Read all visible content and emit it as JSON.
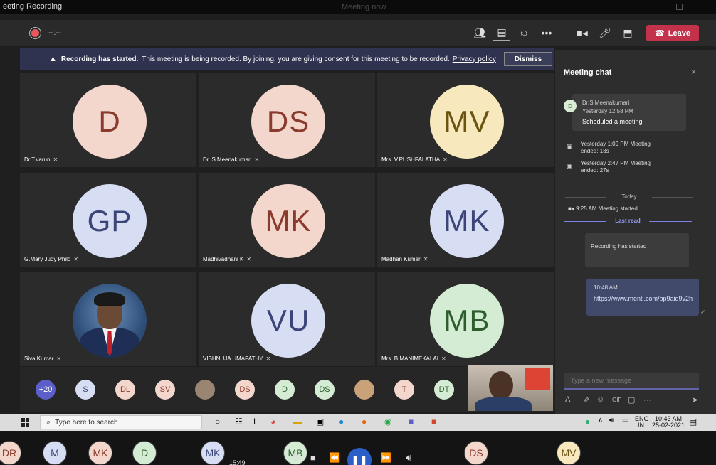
{
  "titlebar": {
    "title": "eeting Recording",
    "center": "Meeting now"
  },
  "controls": {
    "timer": "--:--",
    "leave_label": "Leave",
    "icons": [
      "participants-icon",
      "chat-icon",
      "reactions-icon",
      "more-icon",
      "camera-icon",
      "mic-icon",
      "share-icon"
    ]
  },
  "banner": {
    "bold": "Recording has started.",
    "text": "This meeting is being recorded. By joining, you are giving consent for this meeting to be recorded.",
    "link": "Privacy policy",
    "dismiss": "Dismiss"
  },
  "tiles": [
    {
      "initials": "D",
      "name": "Dr.T.varun",
      "bg": "#f3d6cc",
      "fg": "#8a3b2e"
    },
    {
      "initials": "DS",
      "name": "Dr. S.Meenakumari",
      "bg": "#f3d6cc",
      "fg": "#8a3b2e"
    },
    {
      "initials": "MV",
      "name": "Mrs. V.PUSHPALATHA",
      "bg": "#f7e8bd",
      "fg": "#6b5310"
    },
    {
      "initials": "GP",
      "name": "G.Mary Judy Philo",
      "bg": "#d7def4",
      "fg": "#3b4577"
    },
    {
      "initials": "MK",
      "name": "Madhivadhani K",
      "bg": "#f3d6cc",
      "fg": "#8a3b2e"
    },
    {
      "initials": "MK",
      "name": "Madhan Kumar",
      "bg": "#d7def4",
      "fg": "#3b4577"
    },
    {
      "initials": "",
      "name": "Siva Kumar",
      "bg": "",
      "fg": ""
    },
    {
      "initials": "VU",
      "name": "VISHNUJA UMAPATHY",
      "bg": "#d7def4",
      "fg": "#3b4577"
    },
    {
      "initials": "MB",
      "name": "Mrs. B.MANIMEKALAI",
      "bg": "#d4ecd4",
      "fg": "#2e5e2e"
    }
  ],
  "strip": [
    {
      "label": "+20",
      "bg": "#5b5fc7",
      "fg": "#fff"
    },
    {
      "label": "S",
      "bg": "#d7def4",
      "fg": "#3b4577"
    },
    {
      "label": "DL",
      "bg": "#f3d6cc",
      "fg": "#8a3b2e"
    },
    {
      "label": "SV",
      "bg": "#f3d6cc",
      "fg": "#8a3b2e"
    },
    {
      "label": "",
      "bg": "#9a8472",
      "fg": "#fff"
    },
    {
      "label": "DS",
      "bg": "#f3d6cc",
      "fg": "#8a3b2e"
    },
    {
      "label": "D",
      "bg": "#d4ecd4",
      "fg": "#2e5e2e"
    },
    {
      "label": "DS",
      "bg": "#d4ecd4",
      "fg": "#2e5e2e"
    },
    {
      "label": "",
      "bg": "#c9a27a",
      "fg": "#fff"
    },
    {
      "label": "T",
      "bg": "#f3d6cc",
      "fg": "#8a3b2e"
    },
    {
      "label": "DT",
      "bg": "#d4ecd4",
      "fg": "#2e5e2e"
    }
  ],
  "chat": {
    "title": "Meeting chat",
    "close": "×",
    "msg1": {
      "avatar": "D",
      "author": "Dr.S.Meenakumari",
      "time": "Yesterday 12:58 PM",
      "text": "Scheduled a meeting"
    },
    "events": [
      {
        "line1": "Yesterday 1:09 PM  Meeting",
        "line2": "ended: 13s"
      },
      {
        "line1": "Yesterday 2:47 PM  Meeting",
        "line2": "ended: 27s"
      }
    ],
    "today": "Today",
    "started": "9:25 AM   Meeting started",
    "last_read": "Last read",
    "msg2": "Recording has started",
    "msg3": {
      "time": "10:48 AM",
      "url": "https://www.menti.com/bp9aiq9v2h"
    },
    "compose_placeholder": "Type a new message"
  },
  "taskbar": {
    "search_placeholder": "Type here to search",
    "lang1": "ENG",
    "lang2": "IN",
    "time": "10:43 AM",
    "date": "25-02-2021"
  },
  "player": {
    "time": "15:49",
    "bubbles": [
      {
        "label": "DR",
        "bg": "#f3d6cc",
        "fg": "#8a3b2e"
      },
      {
        "label": "M",
        "bg": "#d7def4",
        "fg": "#3b4577"
      },
      {
        "label": "MK",
        "bg": "#f3d6cc",
        "fg": "#8a3b2e"
      },
      {
        "label": "D",
        "bg": "#d4ecd4",
        "fg": "#2e5e2e"
      },
      {
        "label": "MK",
        "bg": "#d7def4",
        "fg": "#3b4577"
      },
      {
        "label": "MB",
        "bg": "#d4ecd4",
        "fg": "#2e5e2e"
      },
      {
        "label": "DS",
        "bg": "#f3d6cc",
        "fg": "#8a3b2e"
      },
      {
        "label": "MV",
        "bg": "#f7e8bd",
        "fg": "#6b5310"
      }
    ]
  }
}
